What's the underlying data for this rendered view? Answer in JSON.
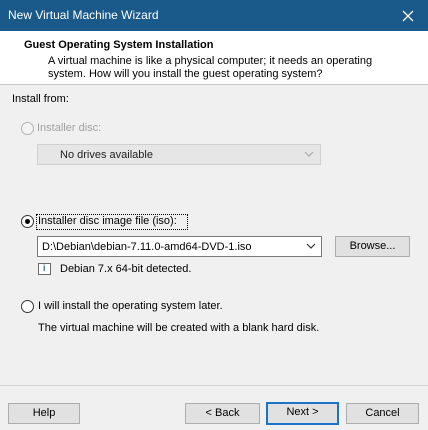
{
  "window": {
    "title": "New Virtual Machine Wizard"
  },
  "header": {
    "title": "Guest Operating System Installation",
    "description": "A virtual machine is like a physical computer; it needs an operating system. How will you install the guest operating system?"
  },
  "install_from": {
    "label": "Install from:",
    "options": [
      {
        "label": "Installer disc:",
        "selected": false,
        "enabled": false,
        "dropdown_value": "No drives available"
      },
      {
        "label": "Installer disc image file (iso):",
        "selected": true,
        "enabled": true,
        "dropdown_value": "D:\\Debian\\debian-7.11.0-amd64-DVD-1.iso",
        "browse_label": "Browse...",
        "detected_text": "Debian 7.x 64-bit detected."
      },
      {
        "label": "I will install the operating system later.",
        "selected": false,
        "enabled": true,
        "note": "The virtual machine will be created with a blank hard disk."
      }
    ]
  },
  "footer": {
    "help": "Help",
    "back": "< Back",
    "next": "Next >",
    "cancel": "Cancel"
  },
  "colors": {
    "titlebar": "#1a5a8a",
    "default_button_border": "#1a73c8"
  }
}
